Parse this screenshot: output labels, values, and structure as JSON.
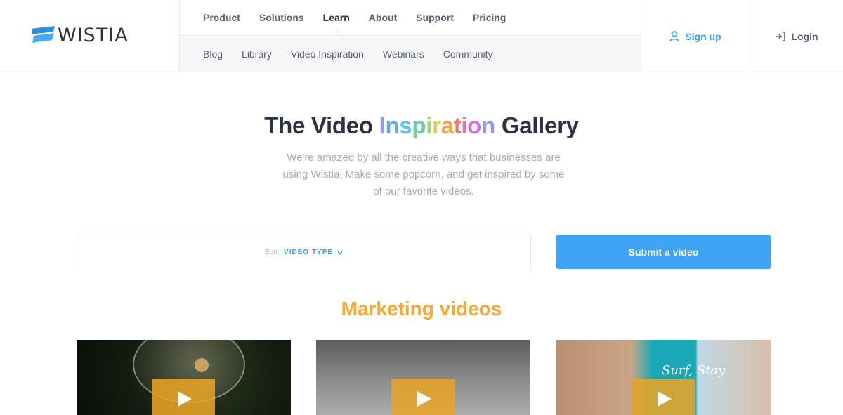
{
  "brand": {
    "name": "WISTIA"
  },
  "nav": {
    "primary": [
      {
        "label": "Product"
      },
      {
        "label": "Solutions"
      },
      {
        "label": "Learn",
        "active": true
      },
      {
        "label": "About"
      },
      {
        "label": "Support"
      },
      {
        "label": "Pricing"
      }
    ],
    "secondary": [
      {
        "label": "Blog"
      },
      {
        "label": "Library"
      },
      {
        "label": "Video Inspiration"
      },
      {
        "label": "Webinars"
      },
      {
        "label": "Community"
      }
    ]
  },
  "account": {
    "signup_label": "Sign up",
    "login_label": "Login",
    "signup_icon": "user-icon",
    "login_icon": "login-arrow-icon"
  },
  "hero": {
    "title_pre": "The Video ",
    "title_letters": [
      "I",
      "n",
      "s",
      "p",
      "i",
      "r",
      "a",
      "t",
      "i",
      "o",
      "n"
    ],
    "title_post": " Gallery",
    "subtitle": "We're amazed by all the creative ways that businesses are using Wistia. Make some popcorn, and get inspired by some of our favorite videos."
  },
  "controls": {
    "sort_label": "Sort:",
    "sort_value": "VIDEO TYPE",
    "submit_label": "Submit a video"
  },
  "section": {
    "title": "Marketing videos",
    "cards": [
      {
        "icon": "play-icon"
      },
      {
        "icon": "play-icon"
      },
      {
        "icon": "play-icon",
        "overlay_text": "Surf, Stay"
      }
    ]
  },
  "colors": {
    "accent_blue": "#40a4f4",
    "section_orange": "#f5a93a",
    "play_overlay": "#e6a428",
    "text_dark": "#2e3240"
  }
}
